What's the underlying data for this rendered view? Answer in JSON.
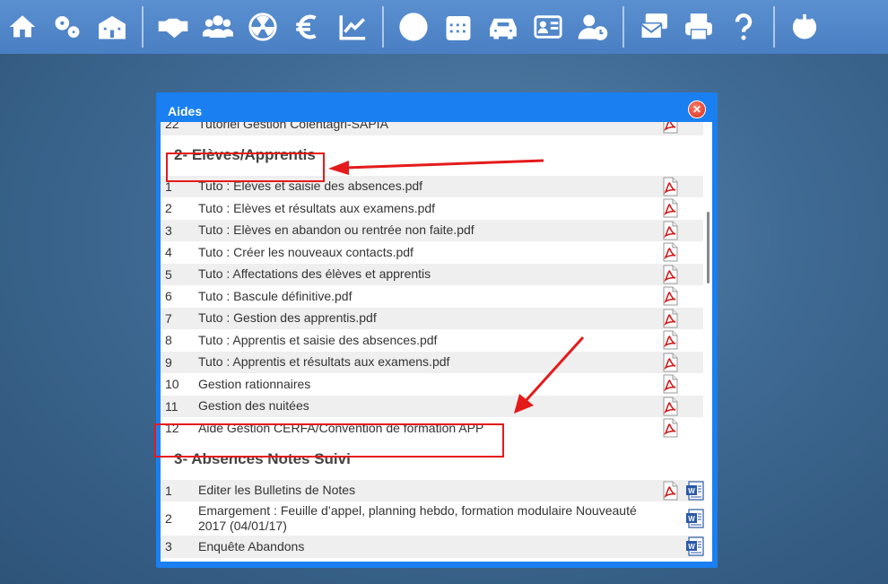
{
  "toolbar": {
    "groups": [
      [
        "home-icon",
        "gears-icon",
        "school-icon"
      ],
      [
        "handshake-icon",
        "users-icon",
        "radiation-icon",
        "euro-icon",
        "chart-line-icon"
      ],
      [
        "globe-icon",
        "calendar-icon",
        "car-icon",
        "id-card-icon",
        "user-clock-icon"
      ],
      [
        "mail-stack-icon",
        "print-icon",
        "help-icon"
      ],
      [
        "power-icon"
      ]
    ]
  },
  "dialog": {
    "title": "Aides",
    "partial_top_row": {
      "num": "22",
      "label": "Tutoriel Gestion Colentagri-SAPIA"
    },
    "section2": {
      "title": "2- Elèves/Apprentis",
      "rows": [
        {
          "num": "1",
          "label": "Tuto : Elèves et saisie des absences.pdf"
        },
        {
          "num": "2",
          "label": "Tuto : Elèves et résultats aux examens.pdf"
        },
        {
          "num": "3",
          "label": "Tuto : Elèves en abandon ou rentrée non faite.pdf"
        },
        {
          "num": "4",
          "label": "Tuto : Créer les nouveaux contacts.pdf"
        },
        {
          "num": "5",
          "label": "Tuto : Affectations des élèves et apprentis"
        },
        {
          "num": "6",
          "label": "Tuto : Bascule définitive.pdf"
        },
        {
          "num": "7",
          "label": "Tuto : Gestion des apprentis.pdf"
        },
        {
          "num": "8",
          "label": "Tuto : Apprentis et saisie des absences.pdf"
        },
        {
          "num": "9",
          "label": "Tuto : Apprentis et résultats aux examens.pdf"
        },
        {
          "num": "10",
          "label": "Gestion rationnaires"
        },
        {
          "num": "11",
          "label": "Gestion des nuitées"
        },
        {
          "num": "12",
          "label": "Aide Gestion CERFA/Convention de formation APP"
        }
      ]
    },
    "section3": {
      "title": "3- Absences Notes Suivi",
      "rows": [
        {
          "num": "1",
          "label": "Editer les Bulletins de Notes"
        },
        {
          "num": "2",
          "label": "Emargement : Feuille d’appel, planning hebdo, formation modulaire Nouveauté 2017 (04/01/17)"
        },
        {
          "num": "3",
          "label": "Enquête Abandons"
        }
      ]
    }
  },
  "colors": {
    "toolbar": "#4f86c9",
    "dialog": "#1a7ff0",
    "highlight": "#e41b1b",
    "pdf": "#d01c1c",
    "word": "#2a5aa8"
  }
}
